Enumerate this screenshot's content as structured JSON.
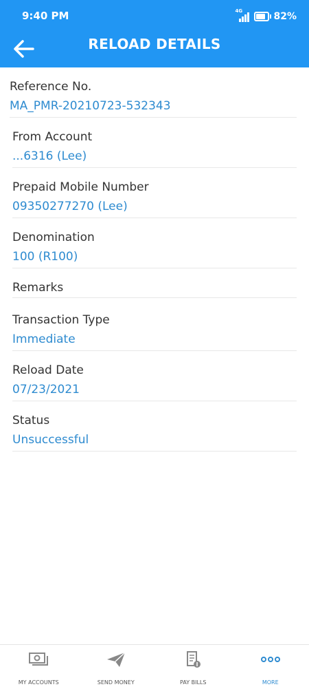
{
  "status_bar": {
    "time": "9:40 PM",
    "network": "4G",
    "battery": "82%",
    "battery_level": 0.82
  },
  "header": {
    "title": "RELOAD DETAILS",
    "back_icon": "arrow-left-icon"
  },
  "details": [
    {
      "label": "Reference No.",
      "value": "MA_PMR-20210723-532343"
    },
    {
      "label": "From Account",
      "value": "...6316 (Lee)"
    },
    {
      "label": "Prepaid Mobile Number",
      "value": "09350277270 (Lee)"
    },
    {
      "label": "Denomination",
      "value": "100 (R100)"
    },
    {
      "label": "Remarks",
      "value": ""
    },
    {
      "label": "Transaction Type",
      "value": "Immediate"
    },
    {
      "label": "Reload Date",
      "value": "07/23/2021"
    },
    {
      "label": "Status",
      "value": "Unsuccessful"
    }
  ],
  "bottom_nav": [
    {
      "label": "MY ACCOUNTS",
      "icon": "cash-icon",
      "active": false
    },
    {
      "label": "SEND MONEY",
      "icon": "paper-plane-icon",
      "active": false
    },
    {
      "label": "PAY BILLS",
      "icon": "bill-icon",
      "active": false
    },
    {
      "label": "MORE",
      "icon": "more-dots-icon",
      "active": true
    }
  ],
  "colors": {
    "primary": "#2196f3",
    "value_text": "#2e8bd0",
    "label_text": "#333333"
  }
}
